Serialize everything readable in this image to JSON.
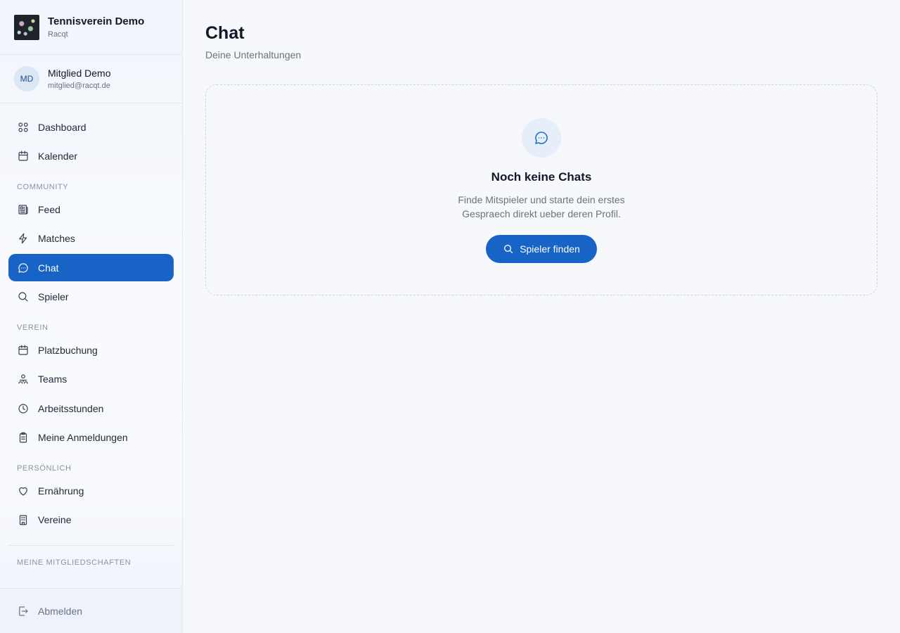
{
  "org": {
    "name": "Tennisverein Demo",
    "sub": "Racqt"
  },
  "user": {
    "initials": "MD",
    "name": "Mitglied Demo",
    "email": "mitglied@racqt.de"
  },
  "nav": {
    "top": [
      {
        "label": "Dashboard",
        "icon": "dashboard-icon"
      },
      {
        "label": "Kalender",
        "icon": "calendar-icon"
      }
    ],
    "sections": {
      "community": "COMMUNITY",
      "verein": "VEREIN",
      "persoenlich": "PERSÖNLICH",
      "mitgliedschaften": "MEINE MITGLIEDSCHAFTEN"
    },
    "community": [
      {
        "label": "Feed",
        "icon": "newspaper-icon"
      },
      {
        "label": "Matches",
        "icon": "lightning-icon"
      },
      {
        "label": "Chat",
        "icon": "chat-bubble-icon",
        "active": true
      },
      {
        "label": "Spieler",
        "icon": "search-icon"
      }
    ],
    "verein": [
      {
        "label": "Platzbuchung",
        "icon": "calendar-icon"
      },
      {
        "label": "Teams",
        "icon": "team-icon"
      },
      {
        "label": "Arbeitsstunden",
        "icon": "clock-icon"
      },
      {
        "label": "Meine Anmeldungen",
        "icon": "clipboard-icon"
      }
    ],
    "persoenlich": [
      {
        "label": "Ernährung",
        "icon": "heart-icon"
      },
      {
        "label": "Vereine",
        "icon": "building-icon"
      }
    ],
    "logout": "Abmelden"
  },
  "page": {
    "title": "Chat",
    "subtitle": "Deine Unterhaltungen"
  },
  "empty_state": {
    "icon": "chat-bubble-icon",
    "title": "Noch keine Chats",
    "description": "Finde Mitspieler und starte dein erstes Gespraech direkt ueber deren Profil.",
    "button_label": "Spieler finden"
  },
  "colors": {
    "accent": "#1763c6",
    "sidebar_bg": "#f4f7fc",
    "text": "#111827",
    "muted": "#6b7280"
  }
}
